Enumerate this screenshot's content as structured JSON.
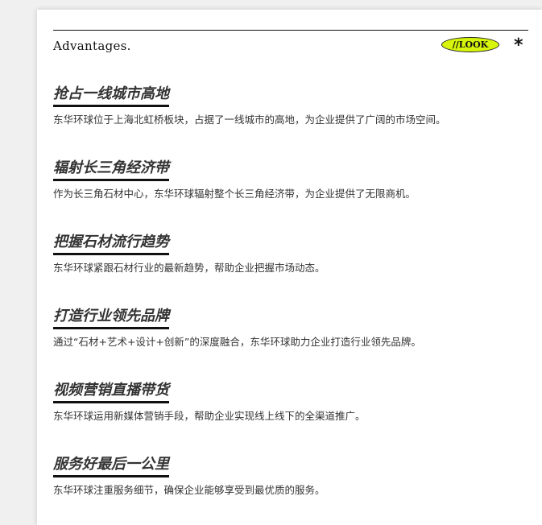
{
  "header": {
    "title": "Advantages.",
    "badge_label": "//LOOK",
    "asterisk": "*"
  },
  "advantages": [
    {
      "title": "抢占一线城市高地",
      "desc": "东华环球位于上海北虹桥板块，占据了一线城市的高地，为企业提供了广阔的市场空间。"
    },
    {
      "title": "辐射长三角经济带",
      "desc": "作为长三角石材中心，东华环球辐射整个长三角经济带，为企业提供了无限商机。"
    },
    {
      "title": "把握石材流行趋势",
      "desc": "东华环球紧跟石材行业的最新趋势，帮助企业把握市场动态。"
    },
    {
      "title": "打造行业领先品牌",
      "desc": "通过“石材+艺术+设计+创新”的深度融合，东华环球助力企业打造行业领先品牌。"
    },
    {
      "title": "视频营销直播带货",
      "desc": "东华环球运用新媒体营销手段，帮助企业实现线上线下的全渠道推广。"
    },
    {
      "title": "服务好最后一公里",
      "desc": "东华环球注重服务细节，确保企业能够享受到最优质的服务。"
    }
  ]
}
